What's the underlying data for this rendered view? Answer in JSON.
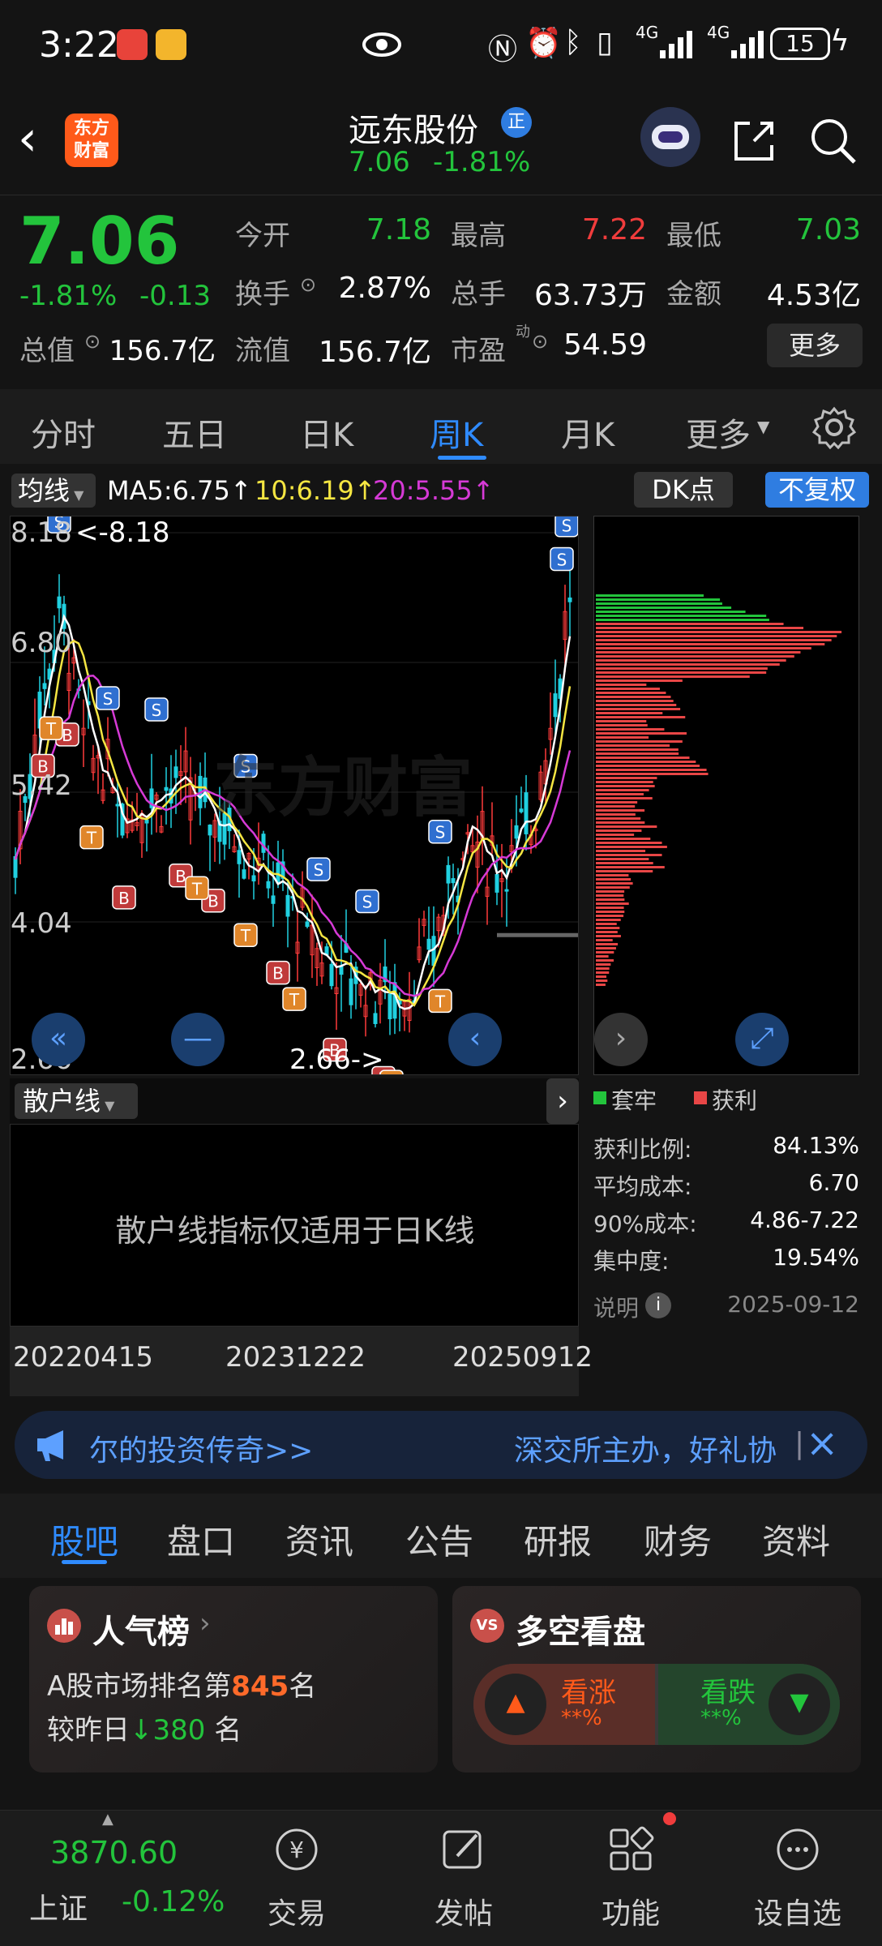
{
  "status_bar": {
    "time": "3:22",
    "network_1": "4G",
    "network_2": "4G",
    "battery": "15"
  },
  "header": {
    "logo_line1": "东方",
    "logo_line2": "财富",
    "stock_name": "远东股份",
    "badge": "正",
    "price": "7.06",
    "change_pct": "-1.81%"
  },
  "quote": {
    "price": "7.06",
    "change_pct": "-1.81%",
    "change": "-0.13",
    "open_label": "今开",
    "open": "7.18",
    "high_label": "最高",
    "high": "7.22",
    "low_label": "最低",
    "low": "7.03",
    "turnover_label": "换手",
    "turnover": "2.87%",
    "volume_label": "总手",
    "volume": "63.73万",
    "amount_label": "金额",
    "amount": "4.53亿",
    "mktcap_label": "总值",
    "mktcap": "156.7亿",
    "float_label": "流值",
    "float": "156.7亿",
    "pe_label": "市盈",
    "pe_sup": "动",
    "pe": "54.59",
    "more": "更多"
  },
  "k_tabs": [
    "分时",
    "五日",
    "日K",
    "周K",
    "月K",
    "更多"
  ],
  "k_tab_active": 3,
  "chart_header": {
    "ma_button": "均线",
    "ma5": "MA5:6.75↑",
    "ma10": "10:6.19↑",
    "ma20": "20:5.55↑",
    "dk": "DK点",
    "fq": "不复权"
  },
  "chart_data": {
    "type": "candlestick",
    "y_labels": [
      "8.18",
      "6.80",
      "5.42",
      "4.04",
      "2.66"
    ],
    "ylim": [
      2.66,
      8.18
    ],
    "max_annotation": "<-8.18",
    "min_annotation": "2.66->",
    "x_labels": [
      "20220415",
      "20231222",
      "20250912"
    ],
    "watermark": "东方财富",
    "ma_colors": {
      "ma5": "#ffffff",
      "ma10": "#f5e642",
      "ma20": "#d63ad6"
    }
  },
  "cyq": {
    "legend_trapped": "套牢",
    "legend_profit": "获利",
    "profit_ratio_label": "获利比例:",
    "profit_ratio": "84.13%",
    "avg_cost_label": "平均成本:",
    "avg_cost": "6.70",
    "cost90_label": "90%成本:",
    "cost90": "4.86-7.22",
    "concentration_label": "集中度:",
    "concentration": "19.54%",
    "note_label": "说明",
    "date": "2025-09-12"
  },
  "sub_chart": {
    "button": "散户线",
    "message": "散户线指标仅适用于日K线"
  },
  "marquee": {
    "text_left": "尔的投资传奇>>",
    "text_right": "深交所主办，好礼协",
    "separator": "|"
  },
  "bottom_tabs": [
    "股吧",
    "盘口",
    "资讯",
    "公告",
    "研报",
    "财务",
    "资料"
  ],
  "bottom_tab_active": 0,
  "popularity": {
    "title": "人气榜",
    "line1_prefix": "A股市场排名第",
    "rank": "845",
    "line1_suffix": "名",
    "line2_prefix": "较昨日",
    "delta": "380",
    "line2_suffix": "名"
  },
  "sentiment": {
    "title": "多空看盘",
    "bull": "看涨",
    "bull_val": "**%",
    "bear": "看跌",
    "bear_val": "**%"
  },
  "bottom_nav": {
    "index_value": "3870.60",
    "index_name": "上证",
    "index_change": "-0.12%",
    "items": [
      "交易",
      "发帖",
      "功能",
      "设自选"
    ]
  }
}
